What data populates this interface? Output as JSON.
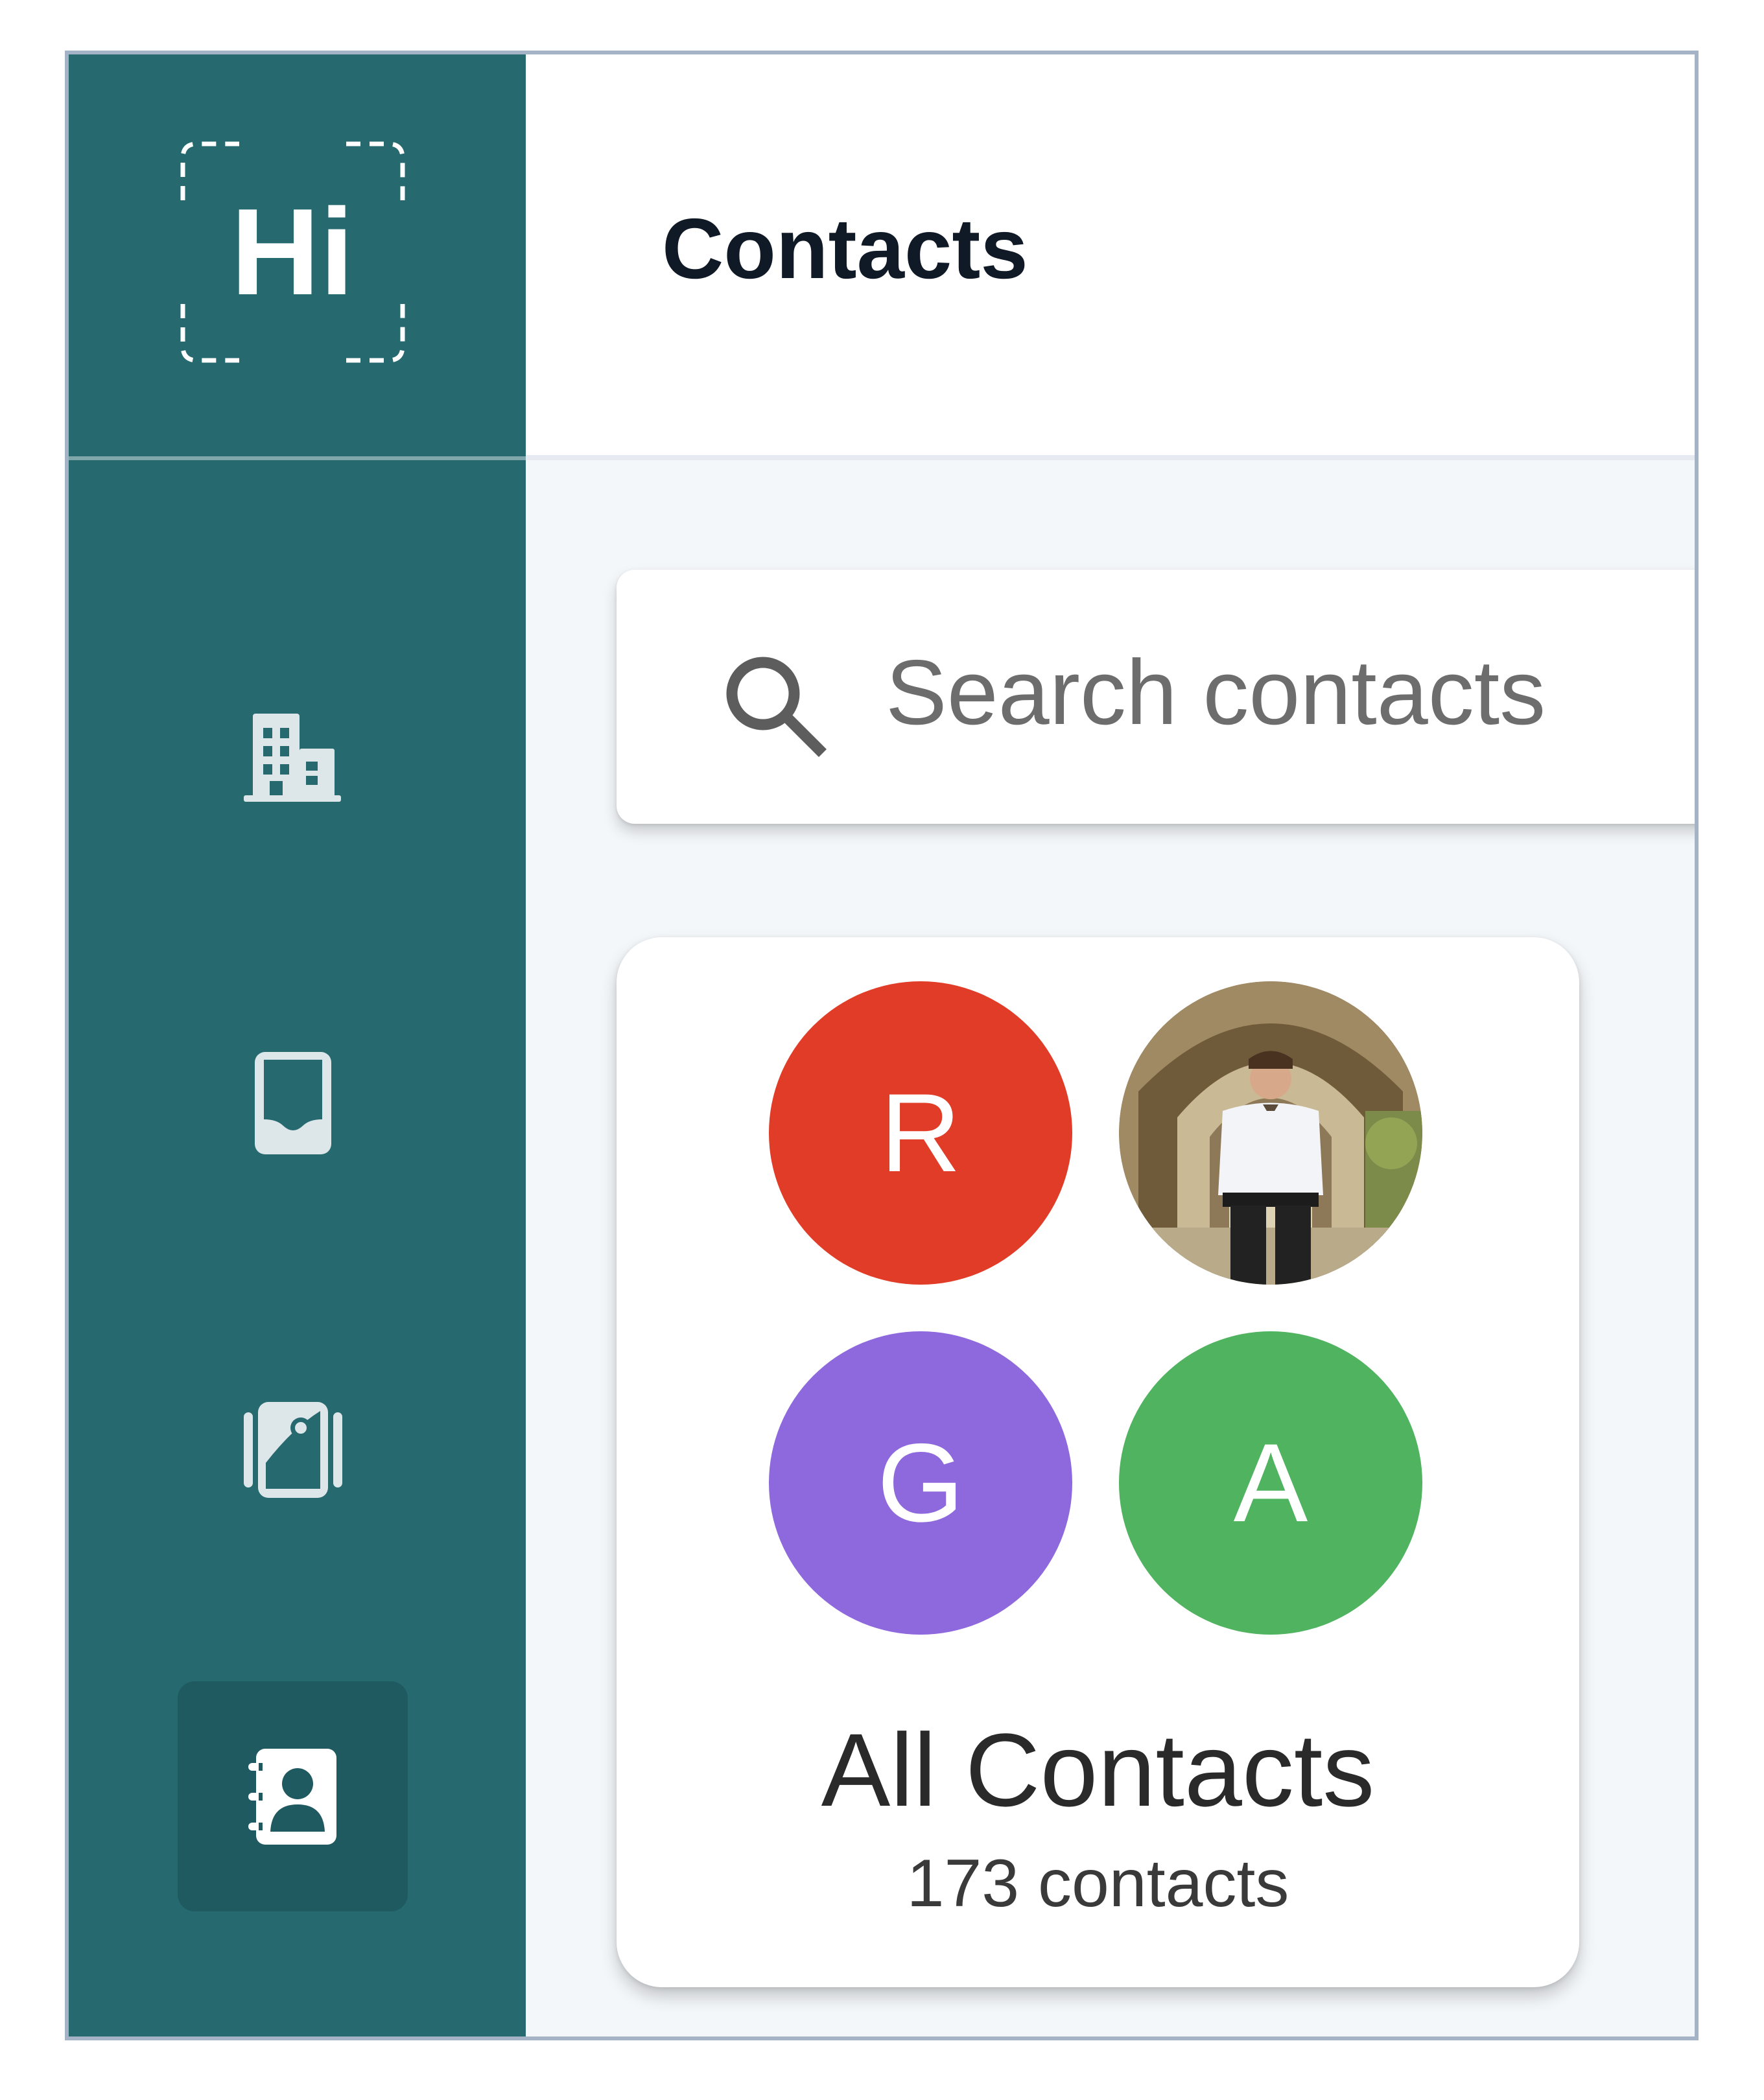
{
  "app": {
    "logo_text": "Hi"
  },
  "sidebar": {
    "items": [
      {
        "icon": "building-icon",
        "active": false
      },
      {
        "icon": "inbox-icon",
        "active": false
      },
      {
        "icon": "photo-album-icon",
        "active": false
      },
      {
        "icon": "contact-book-icon",
        "active": true
      }
    ]
  },
  "header": {
    "title": "Contacts"
  },
  "search": {
    "placeholder": "Search contacts",
    "icon": "search-icon"
  },
  "groups": [
    {
      "name": "All Contacts",
      "count_label": "173 contacts",
      "avatars": [
        {
          "type": "initial",
          "letter": "R",
          "color": "#e03c28"
        },
        {
          "type": "photo",
          "description_icon": "person-photo-avatar"
        },
        {
          "type": "initial",
          "letter": "G",
          "color": "#8e69dd"
        },
        {
          "type": "initial",
          "letter": "A",
          "color": "#4fb35f"
        }
      ]
    }
  ],
  "colors": {
    "sidebar": "#266a70",
    "sidebar_active": "#205a61",
    "icon": "#dde6e8",
    "frame_border": "#a4b3c6",
    "content_bg": "#f4f7fa"
  }
}
